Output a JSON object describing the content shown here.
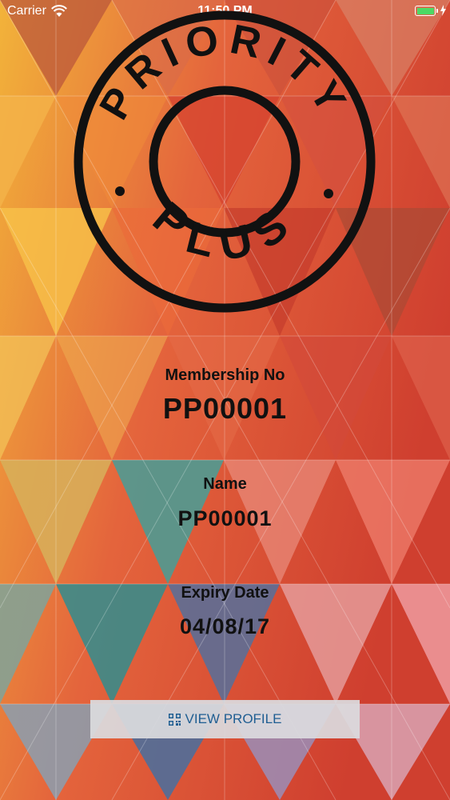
{
  "status_bar": {
    "carrier": "Carrier",
    "time": "11:50 PM",
    "battery_color": "#4cd964"
  },
  "logo": {
    "top_text": "PRIORITY",
    "bottom_text": "PLUS",
    "color": "#111111"
  },
  "card": {
    "membership_label": "Membership No",
    "membership_value": "PP00001",
    "name_label": "Name",
    "name_value": "PP00001",
    "expiry_label": "Expiry Date",
    "expiry_value": "04/08/17"
  },
  "actions": {
    "view_profile_label": "VIEW PROFILE",
    "view_profile_icon": "qr-code-icon",
    "accent_color": "#1f5e92"
  }
}
